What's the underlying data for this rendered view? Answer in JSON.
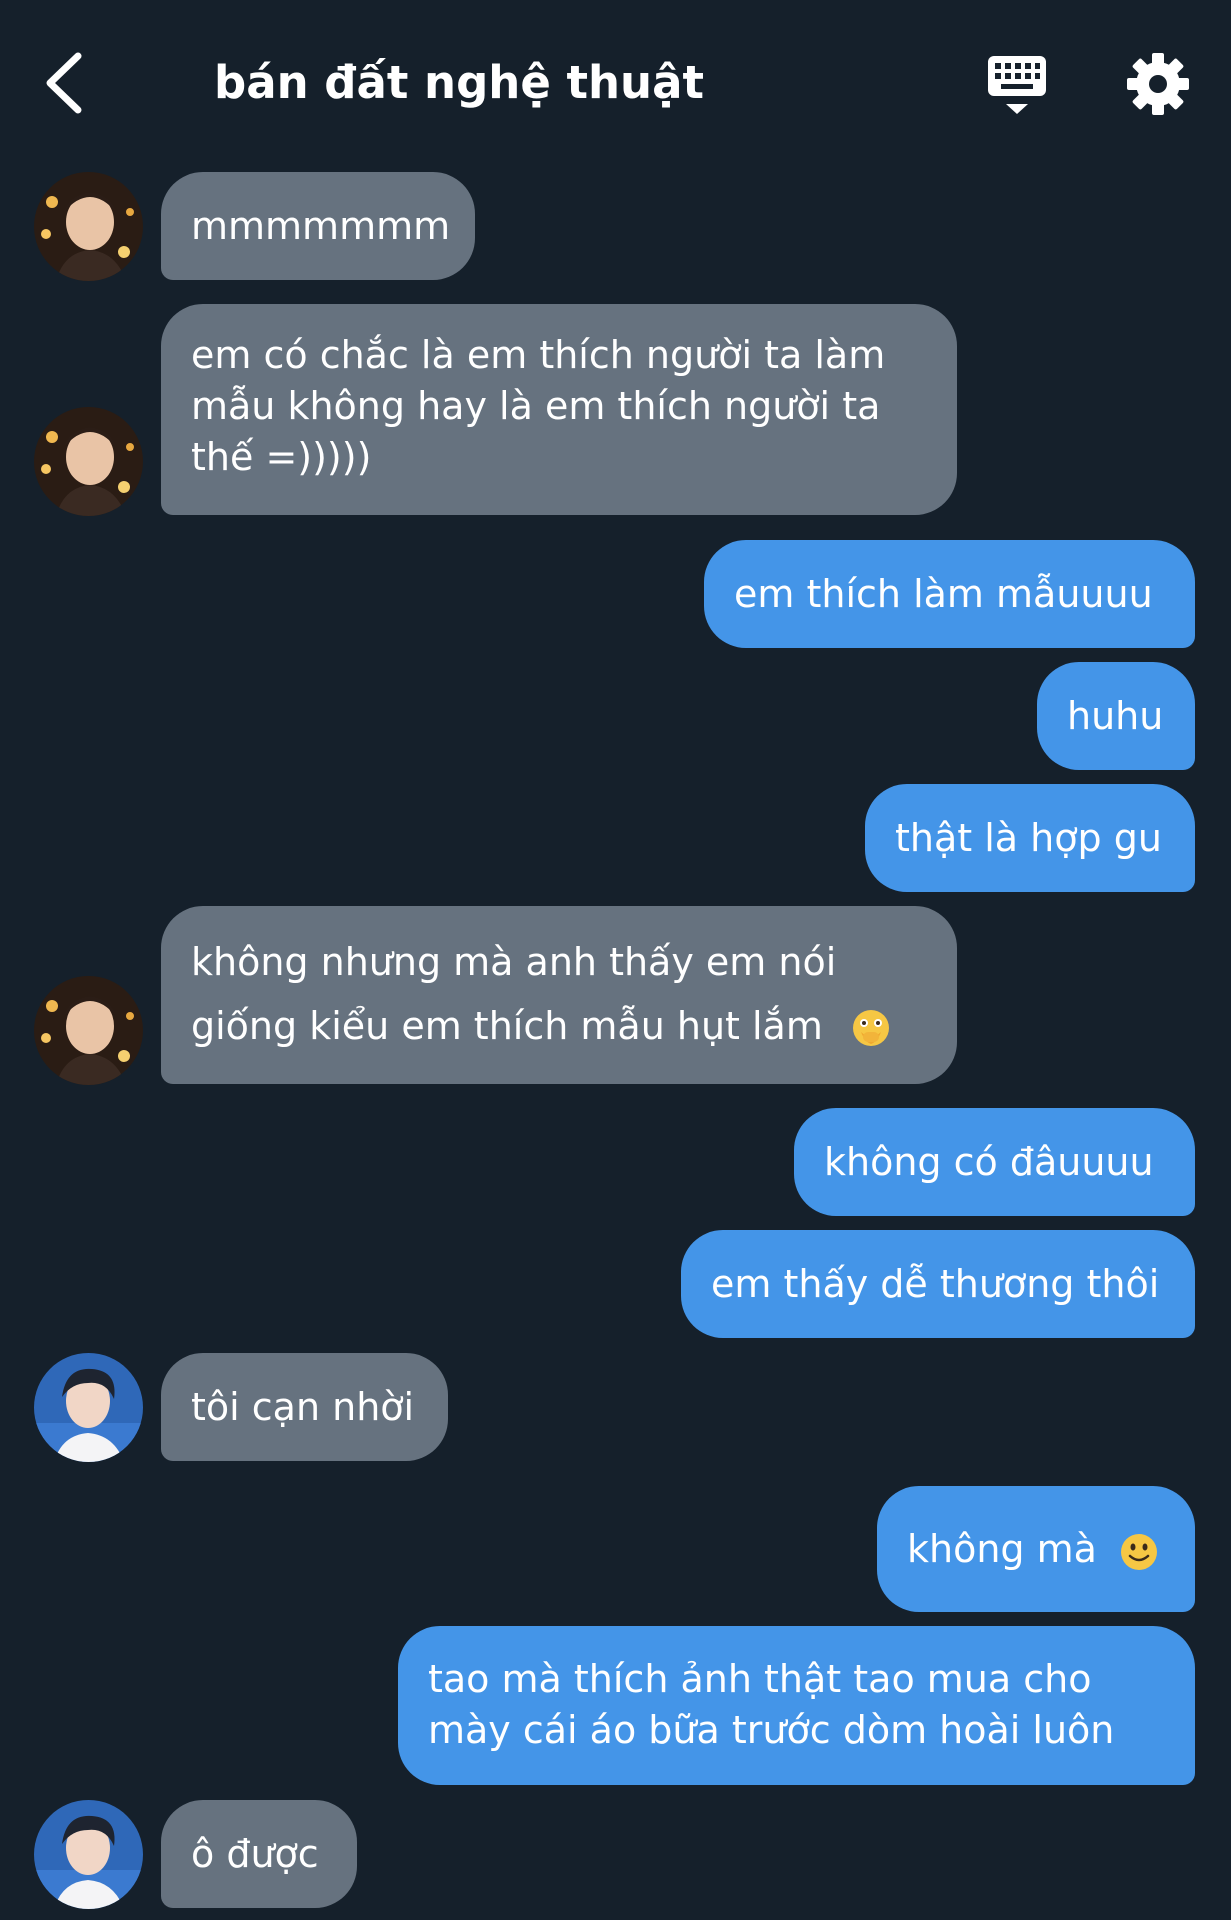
{
  "header": {
    "title": "bán đất nghệ thuật",
    "back_icon": "chevron-left-icon",
    "keyboard_icon": "keyboard-hide-icon",
    "settings_icon": "gear-icon"
  },
  "colors": {
    "background": "#15202b",
    "incoming_bubble": "#66727f",
    "outgoing_bubble": "#4495e8",
    "text": "#ffffff"
  },
  "messages": [
    {
      "side": "incoming",
      "avatar": "avatar-1",
      "text": "mmmmmmm"
    },
    {
      "side": "incoming",
      "avatar": "avatar-1",
      "text": "em có chắc là em thích người ta làm mẫu không hay là em thích người ta thế =)))))"
    },
    {
      "side": "outgoing",
      "text": "em thích làm mẫuuuu"
    },
    {
      "side": "outgoing",
      "text": "huhu"
    },
    {
      "side": "outgoing",
      "text": "thật là hợp gu"
    },
    {
      "side": "incoming",
      "avatar": "avatar-1",
      "text": "không nhưng mà anh thấy em nói giống kiểu em thích mẫu hụt lắm",
      "emoji": "face-with-open-eyes-and-hand-over-mouth-emoji"
    },
    {
      "side": "outgoing",
      "text": "không có đâuuuu"
    },
    {
      "side": "outgoing",
      "text": "em thấy dễ thương thôi"
    },
    {
      "side": "incoming",
      "avatar": "avatar-2",
      "text": "tôi cạn nhời"
    },
    {
      "side": "outgoing",
      "text": "không mà",
      "emoji": "slightly-smiling-face-emoji"
    },
    {
      "side": "outgoing",
      "text": "tao mà thích ảnh thật tao mua cho mày cái áo bữa trước dòm hoài luôn"
    },
    {
      "side": "incoming",
      "avatar": "avatar-2",
      "text": "ô được"
    }
  ]
}
